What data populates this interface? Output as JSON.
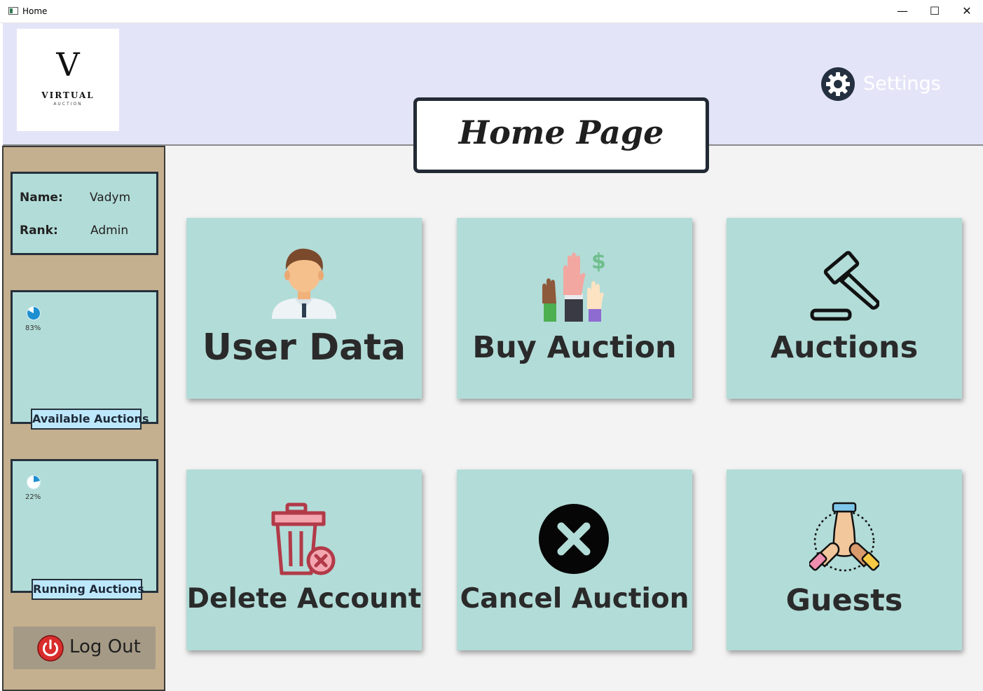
{
  "window": {
    "title": "Home",
    "icon": "app-window-icon",
    "controls": {
      "minimize": "—",
      "maximize": "☐",
      "close": "✕"
    }
  },
  "header": {
    "logo": {
      "mark": "V",
      "name": "VIRTUAL",
      "subtitle": "AUCTION"
    },
    "settings_label": "Settings",
    "settings_icon": "gear-icon",
    "page_title": "Home Page"
  },
  "sidebar": {
    "user": {
      "name_label": "Name:",
      "name_value": "Vadym",
      "rank_label": "Rank:",
      "rank_value": "Admin"
    },
    "stats": [
      {
        "label": "Available Auctions",
        "percent": 83,
        "percent_text": "83%"
      },
      {
        "label": "Running Auctions",
        "percent": 22,
        "percent_text": "22%"
      }
    ],
    "logout_label": "Log Out",
    "logout_icon": "power-icon"
  },
  "tiles": [
    {
      "label": "User Data",
      "icon": "user-avatar-icon"
    },
    {
      "label": "Buy Auction",
      "icon": "raised-hands-dollar-icon"
    },
    {
      "label": "Auctions",
      "icon": "gavel-icon"
    },
    {
      "label": "Delete Account",
      "icon": "trash-delete-icon"
    },
    {
      "label": "Cancel Auction",
      "icon": "cancel-x-icon"
    },
    {
      "label": "Guests",
      "icon": "team-hands-icon"
    }
  ],
  "colors": {
    "header_bg": "#e4e4f8",
    "sidebar_bg": "#c4b08f",
    "tile_bg": "#b2dcd8",
    "stat_label_bg": "#bde8fb",
    "logout_bg": "#a59a86",
    "pie_fill": "#1e8fd0"
  }
}
